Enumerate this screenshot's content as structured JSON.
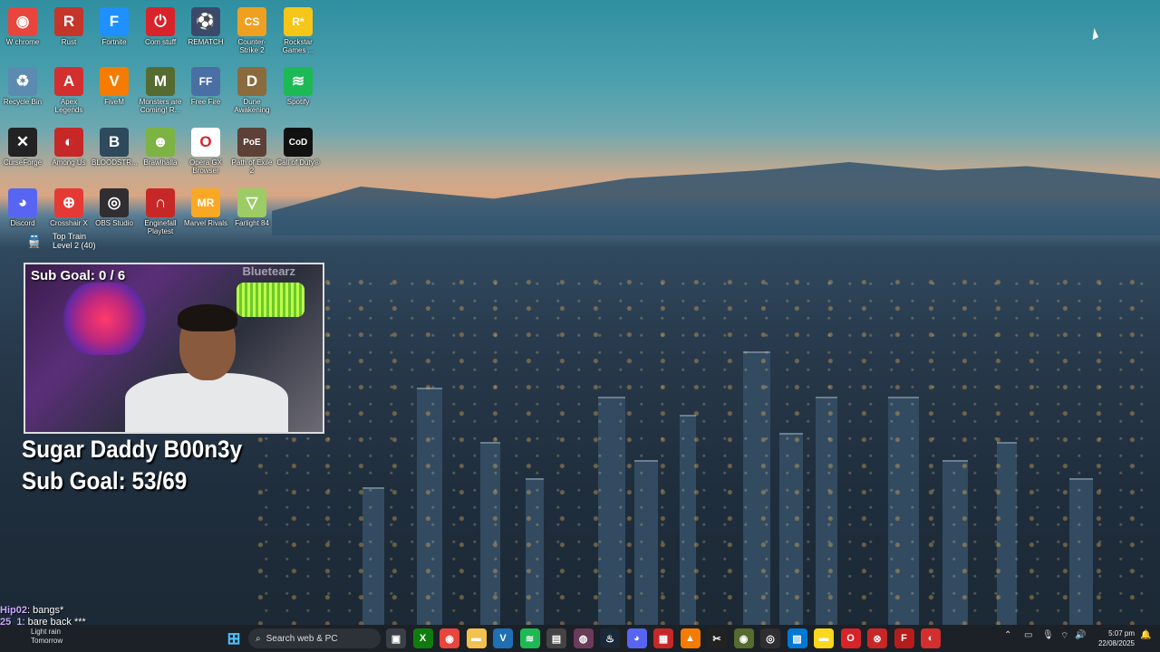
{
  "desktop_icons": [
    {
      "label": "W chrome",
      "icon": "chrome-icon",
      "color": "#e8453c",
      "glyph": "◉"
    },
    {
      "label": "Rust",
      "icon": "rust-icon",
      "color": "#c4352a",
      "glyph": "R"
    },
    {
      "label": "Fortnite",
      "icon": "fortnite-icon",
      "color": "#1e90ff",
      "glyph": "F"
    },
    {
      "label": "Com stuff",
      "icon": "power-icon",
      "color": "#d8232a",
      "glyph": "⏻"
    },
    {
      "label": "REMATCH",
      "icon": "rematch-icon",
      "color": "#3b4a6b",
      "glyph": "⚽"
    },
    {
      "label": "Counter-Strike 2",
      "icon": "cs2-icon",
      "color": "#f0a020",
      "glyph": "CS"
    },
    {
      "label": "Rockstar Games ...",
      "icon": "rockstar-icon",
      "color": "#f5c518",
      "glyph": "R*"
    },
    {
      "label": "Recycle Bin",
      "icon": "recycle-bin-icon",
      "color": "#5b8bb0",
      "glyph": "♻"
    },
    {
      "label": "Apex Legends",
      "icon": "apex-icon",
      "color": "#d32f2f",
      "glyph": "A"
    },
    {
      "label": "FiveM",
      "icon": "fivem-icon",
      "color": "#f57c00",
      "glyph": "V"
    },
    {
      "label": "Monsters are Coming! R...",
      "icon": "monsters-icon",
      "color": "#556b2f",
      "glyph": "M"
    },
    {
      "label": "Free Fire",
      "icon": "free-fire-icon",
      "color": "#4a6fa5",
      "glyph": "FF"
    },
    {
      "label": "Dune Awakening",
      "icon": "dune-icon",
      "color": "#8b6b3d",
      "glyph": "D"
    },
    {
      "label": "Spotify",
      "icon": "spotify-icon",
      "color": "#1db954",
      "glyph": "≋"
    },
    {
      "label": "CurseForge",
      "icon": "curseforge-icon",
      "color": "#222222",
      "glyph": "✕"
    },
    {
      "label": "Among Us",
      "icon": "among-us-icon",
      "color": "#c62828",
      "glyph": "◐"
    },
    {
      "label": "BLOODSTR...",
      "icon": "bloodstrike-icon",
      "color": "#2e4a5c",
      "glyph": "B"
    },
    {
      "label": "Brawlhalla",
      "icon": "brawlhalla-icon",
      "color": "#7cb342",
      "glyph": "☻"
    },
    {
      "label": "Opera GX Browser",
      "icon": "opera-gx-icon",
      "color": "#ffffff",
      "glyph": "O"
    },
    {
      "label": "Path of Exile 2",
      "icon": "poe2-icon",
      "color": "#5d4037",
      "glyph": "PoE"
    },
    {
      "label": "Call of Duty®",
      "icon": "call-of-duty-icon",
      "color": "#111111",
      "glyph": "CoD"
    },
    {
      "label": "Discord",
      "icon": "discord-icon",
      "color": "#5865f2",
      "glyph": "◕"
    },
    {
      "label": "Crosshair X",
      "icon": "crosshair-x-icon",
      "color": "#e53935",
      "glyph": "⊕"
    },
    {
      "label": "OBS Studio",
      "icon": "obs-icon",
      "color": "#302e31",
      "glyph": "◎"
    },
    {
      "label": "Enginefall Playtest",
      "icon": "enginefall-icon",
      "color": "#c62828",
      "glyph": "∩"
    },
    {
      "label": "Marvel Rivals",
      "icon": "marvel-rivals-icon",
      "color": "#f9a825",
      "glyph": "MR"
    },
    {
      "label": "Farlight 84",
      "icon": "farlight-icon",
      "color": "#9ccc65",
      "glyph": "▽"
    }
  ],
  "train": {
    "title": "Top Train",
    "level": "Level 2  (40)"
  },
  "webcam": {
    "goal": "Sub Goal:  0 / 6",
    "watermark": "Bluetearz"
  },
  "overlay": {
    "line1": "Sugar Daddy B00n3y",
    "line2": "Sub Goal: 53/69"
  },
  "chat": [
    {
      "name": "Hip02",
      "text": ": bangs*"
    },
    {
      "name": "25_1",
      "text": ": bare back ***"
    }
  ],
  "weather": {
    "line1": "Light rain",
    "line2": "Tomorrow"
  },
  "taskbar": {
    "search_placeholder": "Search web & PC",
    "apps": [
      {
        "icon": "task-view-icon",
        "color": "#3a4048",
        "glyph": "▣"
      },
      {
        "icon": "xbox-icon",
        "color": "#107c10",
        "glyph": "X"
      },
      {
        "icon": "chrome-icon",
        "color": "#e8453c",
        "glyph": "◉"
      },
      {
        "icon": "file-explorer-icon",
        "color": "#f2c14e",
        "glyph": "▬"
      },
      {
        "icon": "vscode-icon",
        "color": "#1f6fb5",
        "glyph": "V"
      },
      {
        "icon": "spotify-icon",
        "color": "#1db954",
        "glyph": "≋"
      },
      {
        "icon": "app-icon",
        "color": "#444444",
        "glyph": "▤"
      },
      {
        "icon": "app2-icon",
        "color": "#6b3b5a",
        "glyph": "◍"
      },
      {
        "icon": "steam-icon",
        "color": "#1b2838",
        "glyph": "♨"
      },
      {
        "icon": "discord-icon",
        "color": "#5865f2",
        "glyph": "◕"
      },
      {
        "icon": "app3-icon",
        "color": "#c62828",
        "glyph": "▦"
      },
      {
        "icon": "vlc-icon",
        "color": "#f57c00",
        "glyph": "▲"
      },
      {
        "icon": "capcut-icon",
        "color": "#222222",
        "glyph": "✂"
      },
      {
        "icon": "app4-icon",
        "color": "#556b2f",
        "glyph": "◉"
      },
      {
        "icon": "obs-icon",
        "color": "#302e31",
        "glyph": "◎"
      },
      {
        "icon": "photos-icon",
        "color": "#0078d4",
        "glyph": "▨"
      },
      {
        "icon": "sticky-notes-icon",
        "color": "#f9d71c",
        "glyph": "▬"
      },
      {
        "icon": "opera-gx-icon",
        "color": "#d8232a",
        "glyph": "O"
      },
      {
        "icon": "app5-icon",
        "color": "#c62828",
        "glyph": "⊗"
      },
      {
        "icon": "app6-icon",
        "color": "#b71c1c",
        "glyph": "F"
      },
      {
        "icon": "app7-icon",
        "color": "#d32f2f",
        "glyph": "◐"
      }
    ]
  },
  "clock": {
    "time": "5:07 pm",
    "date": "22/08/2025"
  }
}
